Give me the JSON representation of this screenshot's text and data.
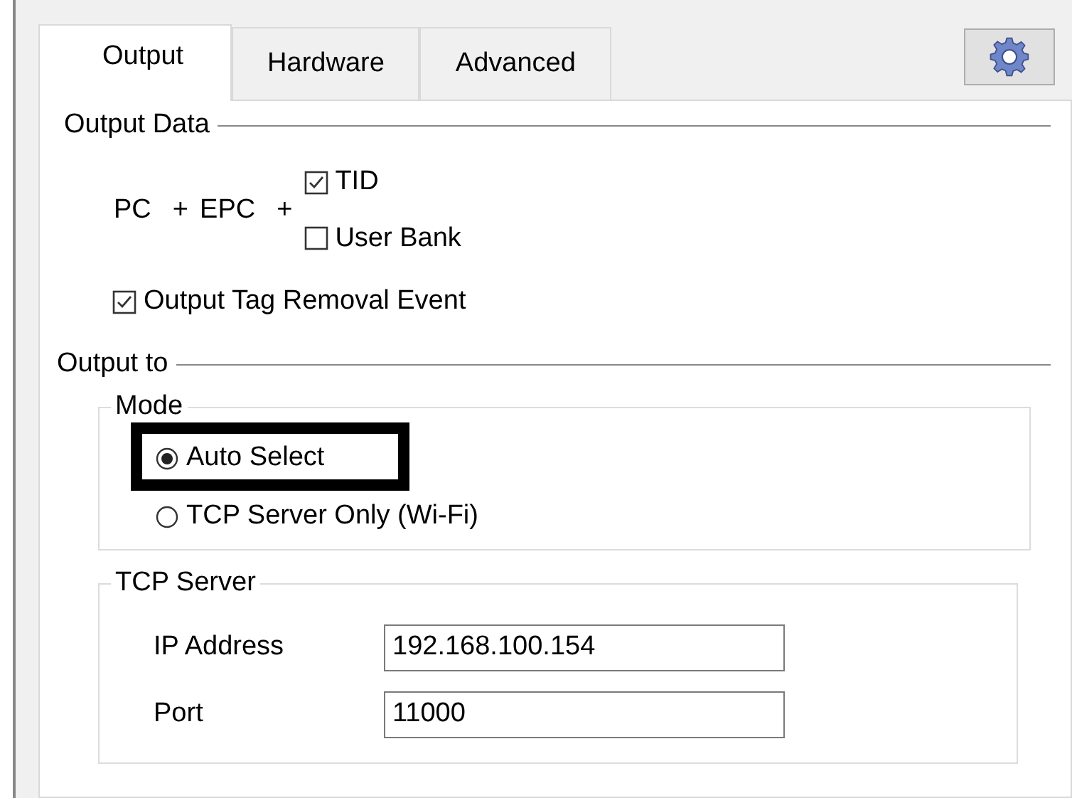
{
  "tabs": [
    {
      "label": "Output",
      "selected": true
    },
    {
      "label": "Hardware",
      "selected": false
    },
    {
      "label": "Advanced",
      "selected": false
    }
  ],
  "output_data": {
    "title": "Output Data",
    "formula": [
      "PC",
      "+",
      "EPC",
      "+"
    ],
    "options": [
      {
        "label": "TID",
        "checked": true
      },
      {
        "label": "User Bank",
        "checked": false
      }
    ],
    "removal_event": {
      "label": "Output Tag Removal Event",
      "checked": true
    }
  },
  "output_to": {
    "title": "Output to",
    "mode": {
      "title": "Mode",
      "options": [
        {
          "label": "Auto  Select",
          "selected": true
        },
        {
          "label": "TCP Server Only (Wi-Fi)",
          "selected": false
        }
      ]
    },
    "tcp_server": {
      "title": "TCP Server",
      "fields": [
        {
          "label": "IP Address",
          "value": "192.168.100.154"
        },
        {
          "label": "Port",
          "value": "11000"
        }
      ]
    }
  }
}
